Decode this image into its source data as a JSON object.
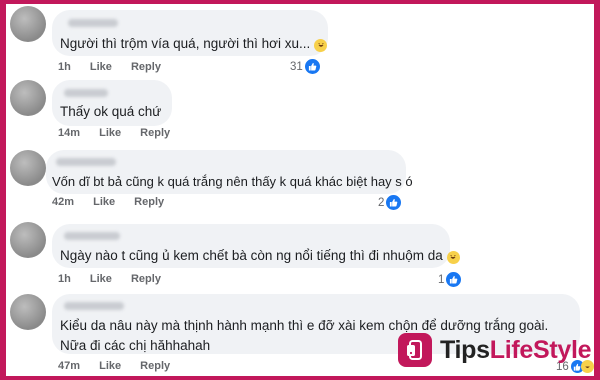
{
  "comments": [
    {
      "text": "Người thì trộm vía quá, người thì hơi xu...",
      "time": "1h",
      "like": "Like",
      "reply": "Reply",
      "reaction_count": "31",
      "reactions": [
        "like-icon"
      ],
      "trailing_emoji": "haha-icon"
    },
    {
      "text": "Thấy ok quá chứ",
      "time": "14m",
      "like": "Like",
      "reply": "Reply",
      "reaction_count": "",
      "reactions": []
    },
    {
      "text": "Vốn dĩ bt bả cũng k quá trắng nên thấy k quá khác biệt hay s ó",
      "time": "42m",
      "like": "Like",
      "reply": "Reply",
      "reaction_count": "2",
      "reactions": [
        "like-icon"
      ]
    },
    {
      "text": "Ngày nào t cũng ủ kem chết bà còn ng nổi tiếng thì đi nhuộm da",
      "time": "1h",
      "like": "Like",
      "reply": "Reply",
      "reaction_count": "1",
      "reactions": [
        "like-icon"
      ],
      "trailing_emoji": "haha-icon"
    },
    {
      "text": "Kiểu da nâu này mà thịnh hành mạnh thì e đỡ xài kem chộn để dưỡng trắng goài. Nữa đi các chị hăhhahah",
      "time": "47m",
      "like": "Like",
      "reply": "Reply",
      "reaction_count": "16",
      "reactions": [
        "like-icon",
        "haha-icon"
      ]
    }
  ],
  "brand": {
    "tips": "Tips",
    "lifestyle": "LifeStyle",
    "accent": "#c2185b"
  },
  "colors": {
    "like": "#1877f2",
    "bubble": "#f0f2f5",
    "meta": "#65676b"
  }
}
